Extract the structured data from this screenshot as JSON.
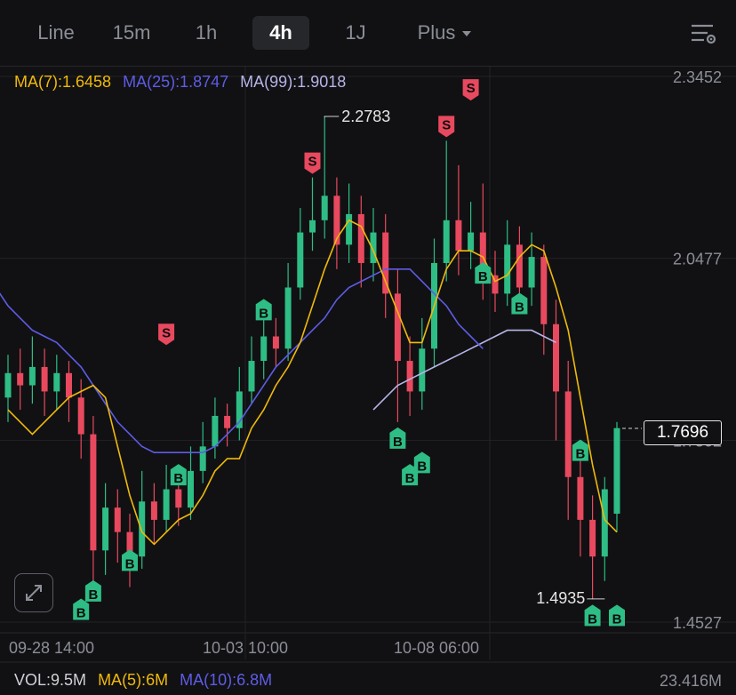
{
  "tabs": [
    {
      "label": "Line",
      "active": false
    },
    {
      "label": "15m",
      "active": false
    },
    {
      "label": "1h",
      "active": false
    },
    {
      "label": "4h",
      "active": true
    },
    {
      "label": "1J",
      "active": false
    },
    {
      "label": "Plus",
      "active": false,
      "dropdown": true
    }
  ],
  "icons": {
    "settings": "chart-settings-icon",
    "expand": "expand-arrows-icon",
    "watermark": "exchange-logo-watermark"
  },
  "colors": {
    "up": "#2ebd85",
    "down": "#e8495e",
    "ma7": "#f0b90b",
    "ma25": "#5e5ce6",
    "ma99": "#b7b4e8",
    "background": "#111113"
  },
  "chart_data": {
    "type": "candlestick",
    "ma_legend": {
      "ma7": "MA(7):1.6458",
      "ma25": "MA(25):1.8747",
      "ma99": "MA(99):1.9018"
    },
    "y_axis_labels": [
      "2.3452",
      "2.0477",
      "1.7502",
      "1.4527"
    ],
    "ylim": [
      1.4527,
      2.3452
    ],
    "x_axis_labels": [
      "09-28 14:00",
      "10-03 10:00",
      "10-08 06:00"
    ],
    "high_marker": "2.2783",
    "low_marker": "1.4935",
    "current_price": "1.7696",
    "volume_legend": {
      "vol": "VOL:9.5M",
      "ma5": "MA(5):6M",
      "ma10": "MA(10):6.8M"
    },
    "volume_axis_label": "23.416M",
    "grid": true,
    "series": [
      {
        "name": "MA(7)",
        "values": [
          1.8,
          1.78,
          1.76,
          1.78,
          1.8,
          1.82,
          1.83,
          1.84,
          1.82,
          1.74,
          1.66,
          1.6,
          1.58,
          1.6,
          1.62,
          1.63,
          1.66,
          1.7,
          1.72,
          1.72,
          1.77,
          1.8,
          1.84,
          1.87,
          1.91,
          1.97,
          2.03,
          2.08,
          2.11,
          2.1,
          2.06,
          2.01,
          1.96,
          1.91,
          1.91,
          1.97,
          2.03,
          2.06,
          2.06,
          2.05,
          2.01,
          2.02,
          2.05,
          2.07,
          2.06,
          2.0,
          1.93,
          1.82,
          1.71,
          1.62,
          1.6
        ]
      },
      {
        "name": "MA(25)",
        "values": [
          2.0,
          1.97,
          1.95,
          1.93,
          1.92,
          1.91,
          1.89,
          1.87,
          1.84,
          1.81,
          1.78,
          1.76,
          1.74,
          1.73,
          1.73,
          1.73,
          1.73,
          1.73,
          1.74,
          1.76,
          1.78,
          1.81,
          1.84,
          1.87,
          1.89,
          1.91,
          1.93,
          1.95,
          1.98,
          2.0,
          2.01,
          2.02,
          2.03,
          2.03,
          2.03,
          2.01,
          1.99,
          1.97,
          1.94,
          1.92,
          1.9
        ]
      },
      {
        "name": "MA(99)",
        "values": [
          1.8,
          1.82,
          1.84,
          1.85,
          1.86,
          1.87,
          1.88,
          1.89,
          1.9,
          1.91,
          1.92,
          1.93,
          1.93,
          1.93,
          1.92,
          1.91
        ]
      },
      {
        "name": "candles",
        "values": [
          [
            1.82,
            1.86,
            1.78,
            1.89
          ],
          [
            1.86,
            1.84,
            1.8,
            1.9
          ],
          [
            1.84,
            1.87,
            1.81,
            1.92
          ],
          [
            1.87,
            1.83,
            1.79,
            1.9
          ],
          [
            1.83,
            1.86,
            1.8,
            1.89
          ],
          [
            1.86,
            1.82,
            1.78,
            1.88
          ],
          [
            1.82,
            1.76,
            1.72,
            1.85
          ],
          [
            1.76,
            1.57,
            1.5,
            1.79
          ],
          [
            1.57,
            1.64,
            1.53,
            1.68
          ],
          [
            1.64,
            1.6,
            1.55,
            1.67
          ],
          [
            1.6,
            1.56,
            1.51,
            1.63
          ],
          [
            1.56,
            1.65,
            1.54,
            1.7
          ],
          [
            1.65,
            1.62,
            1.58,
            1.68
          ],
          [
            1.62,
            1.67,
            1.6,
            1.71
          ],
          [
            1.67,
            1.64,
            1.61,
            1.7
          ],
          [
            1.64,
            1.7,
            1.62,
            1.74
          ],
          [
            1.7,
            1.74,
            1.68,
            1.78
          ],
          [
            1.74,
            1.79,
            1.72,
            1.82
          ],
          [
            1.79,
            1.77,
            1.74,
            1.81
          ],
          [
            1.77,
            1.83,
            1.75,
            1.87
          ],
          [
            1.83,
            1.88,
            1.81,
            1.92
          ],
          [
            1.88,
            1.92,
            1.85,
            1.95
          ],
          [
            1.92,
            1.9,
            1.87,
            1.95
          ],
          [
            1.9,
            2.0,
            1.88,
            2.04
          ],
          [
            2.0,
            2.09,
            1.98,
            2.13
          ],
          [
            2.09,
            2.11,
            2.06,
            2.18
          ],
          [
            2.11,
            2.15,
            2.08,
            2.28
          ],
          [
            2.15,
            2.07,
            2.03,
            2.18
          ],
          [
            2.07,
            2.12,
            2.04,
            2.17
          ],
          [
            2.12,
            2.04,
            2.0,
            2.15
          ],
          [
            2.04,
            2.09,
            2.01,
            2.13
          ],
          [
            2.09,
            1.99,
            1.95,
            2.12
          ],
          [
            1.99,
            1.88,
            1.78,
            2.03
          ],
          [
            1.88,
            1.83,
            1.79,
            1.92
          ],
          [
            1.83,
            1.9,
            1.8,
            1.95
          ],
          [
            1.9,
            2.04,
            1.87,
            2.08
          ],
          [
            2.04,
            2.11,
            2.01,
            2.24
          ],
          [
            2.11,
            2.06,
            2.02,
            2.2
          ],
          [
            2.06,
            2.09,
            2.03,
            2.14
          ],
          [
            2.09,
            2.02,
            1.98,
            2.17
          ],
          [
            2.02,
            1.99,
            1.96,
            2.06
          ],
          [
            1.99,
            2.07,
            1.97,
            2.11
          ],
          [
            2.07,
            2.0,
            1.96,
            2.1
          ],
          [
            2.0,
            2.05,
            1.97,
            2.09
          ],
          [
            2.05,
            1.94,
            1.89,
            2.07
          ],
          [
            1.94,
            1.83,
            1.75,
            1.98
          ],
          [
            1.83,
            1.69,
            1.62,
            1.88
          ],
          [
            1.69,
            1.62,
            1.56,
            1.73
          ],
          [
            1.62,
            1.56,
            1.49,
            1.66
          ],
          [
            1.56,
            1.67,
            1.52,
            1.69
          ],
          [
            1.63,
            1.77,
            1.6,
            1.78
          ]
        ]
      }
    ],
    "signals": [
      {
        "label": "S",
        "kind": "sell",
        "i": 13,
        "price": 1.9
      },
      {
        "label": "S",
        "kind": "sell",
        "i": 25,
        "price": 2.18
      },
      {
        "label": "S",
        "kind": "sell",
        "i": 36,
        "price": 2.24
      },
      {
        "label": "S",
        "kind": "sell",
        "i": 38,
        "price": 2.3
      },
      {
        "label": "B",
        "kind": "buy",
        "i": 6,
        "price": 1.5
      },
      {
        "label": "B",
        "kind": "buy",
        "i": 7,
        "price": 1.53
      },
      {
        "label": "B",
        "kind": "buy",
        "i": 10,
        "price": 1.58
      },
      {
        "label": "B",
        "kind": "buy",
        "i": 14,
        "price": 1.72
      },
      {
        "label": "B",
        "kind": "buy",
        "i": 21,
        "price": 1.99
      },
      {
        "label": "B",
        "kind": "buy",
        "i": 32,
        "price": 1.78
      },
      {
        "label": "B",
        "kind": "buy",
        "i": 33,
        "price": 1.72
      },
      {
        "label": "B",
        "kind": "buy",
        "i": 34,
        "price": 1.74
      },
      {
        "label": "B",
        "kind": "buy",
        "i": 39,
        "price": 2.05
      },
      {
        "label": "B",
        "kind": "buy",
        "i": 42,
        "price": 2.0
      },
      {
        "label": "B",
        "kind": "buy",
        "i": 47,
        "price": 1.76
      },
      {
        "label": "B",
        "kind": "buy",
        "i": 48,
        "price": 1.49
      },
      {
        "label": "B",
        "kind": "buy",
        "i": 50,
        "price": 1.49
      }
    ]
  }
}
